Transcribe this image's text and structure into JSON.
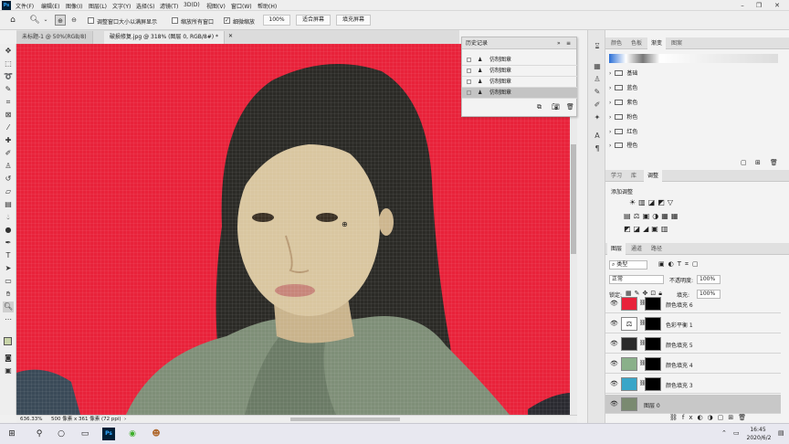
{
  "menubar": {
    "app_icon": "Ps",
    "items": [
      "文件(F)",
      "编辑(E)",
      "图像(I)",
      "图层(L)",
      "文字(Y)",
      "选择(S)",
      "滤镜(T)",
      "3D(D)",
      "视图(V)",
      "窗口(W)",
      "帮助(H)"
    ]
  },
  "options": {
    "resize_windows": "调整窗口大小以满屏显示",
    "zoom_all": "缩放所有窗口",
    "scrubby_zoom": "细微缩放",
    "zoom_value": "100%",
    "fit_screen": "适合屏幕",
    "fill_screen": "填充屏幕"
  },
  "tabs": [
    {
      "label": "未标题-1 @ 50%(RGB/8)"
    },
    {
      "label": "破损修复.jpg @ 318% (图层 0, RGB/8#) *"
    }
  ],
  "history": {
    "title": "历史记录",
    "items": [
      "仿制图章",
      "仿制图章",
      "仿制图章",
      "仿制图章"
    ]
  },
  "status": {
    "zoom": "636.33%",
    "doc_size": "500 像素 x 361 像素 (72 ppi)"
  },
  "gradients": {
    "tabs": [
      "颜色",
      "色板",
      "渐变",
      "图案"
    ],
    "groups": [
      "基础",
      "蓝色",
      "紫色",
      "粉色",
      "红色",
      "橙色"
    ]
  },
  "adjustments": {
    "tabs": [
      "学习",
      "库",
      "调整"
    ],
    "add_label": "添加调整"
  },
  "layers": {
    "tabs": [
      "图层",
      "通道",
      "路径"
    ],
    "kind": "类型",
    "blend_mode": "正常",
    "opacity_label": "不透明度:",
    "opacity": "100%",
    "lock_label": "锁定:",
    "fill_label": "填充:",
    "fill": "100%",
    "items": [
      {
        "name": "颜色填充 6",
        "thumb": "#e8223a"
      },
      {
        "name": "色彩平衡 1",
        "thumb": "#ffffff"
      },
      {
        "name": "颜色填充 5",
        "thumb": "#2a2a2a"
      },
      {
        "name": "颜色填充 4",
        "thumb": "#8ab08a"
      },
      {
        "name": "颜色填充 3",
        "thumb": "#3aa6c8"
      },
      {
        "name": "图层 0",
        "thumb": "#7a8a70"
      }
    ]
  },
  "taskbar": {
    "time": "16:45",
    "date": "2020/6/2"
  },
  "colors": {
    "canvas_bg": "#e8223a",
    "selected_layer": "#c8c8c8"
  }
}
